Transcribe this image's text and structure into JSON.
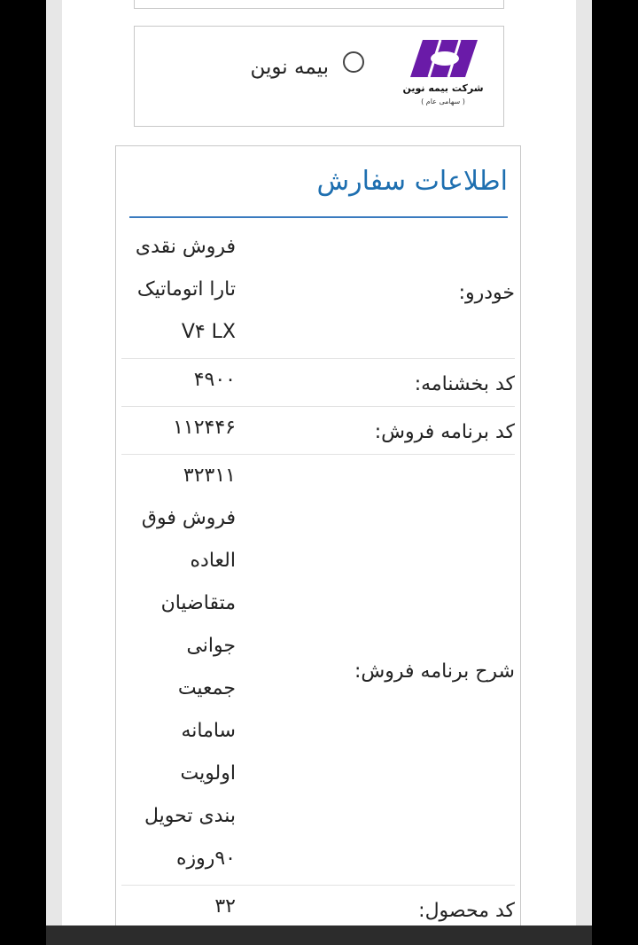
{
  "insurance": {
    "logo_company": "شرکت بیمه نوین",
    "logo_sub": "( سهامی عام )",
    "option_label": "بیمه نوین"
  },
  "order": {
    "title": "اطلاعات سفارش",
    "rows": [
      {
        "label": "خودرو:",
        "value": [
          "فروش نقدی",
          "تارا اتوماتیک",
          "V۴ LX"
        ]
      },
      {
        "label": "کد بخشنامه:",
        "value": [
          "۴۹۰۰"
        ]
      },
      {
        "label": "کد برنامه فروش:",
        "value": [
          "۱۱۲۴۴۶"
        ]
      },
      {
        "label": "شرح برنامه فروش:",
        "value": [
          "۳۲۳۱۱",
          "فروش فوق",
          "العاده",
          "متقاضیان",
          "جوانی",
          "جمعیت",
          "سامانه",
          "اولویت",
          "بندی تحویل",
          "۹۰روزه"
        ]
      },
      {
        "label": "کد محصول:",
        "value": [
          "۳۲"
        ]
      }
    ]
  },
  "colors": {
    "title": "#1e6fb0",
    "rule": "#3a7bbf",
    "logo": "#6a1ba8"
  },
  "icons": [
    "novin-insurance-logo-icon",
    "radio-button-icon"
  ]
}
